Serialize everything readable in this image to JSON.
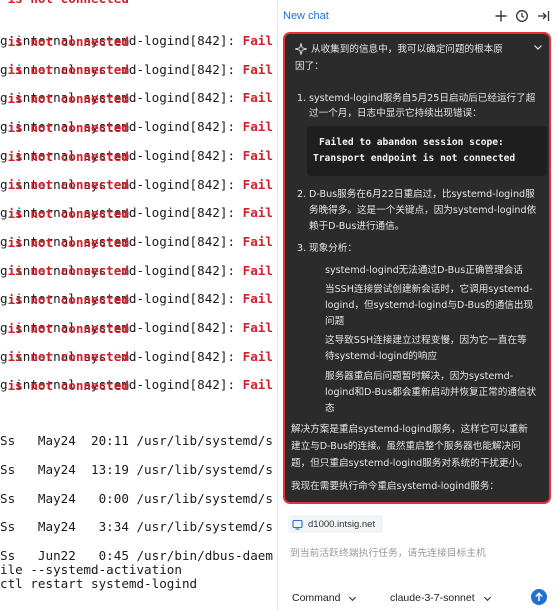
{
  "terminal": {
    "log_prefix": "g.internal systemd-logind[842]: ",
    "fail_word": "Fail",
    "fail_continuation": " is not connected",
    "process_lines": [
      {
        "stat": "Ss",
        "month": "May24",
        "time": "20:11",
        "cmd": "/usr/lib/systemd/s"
      },
      {
        "stat": "Ss",
        "month": "May24",
        "time": "13:19",
        "cmd": "/usr/lib/systemd/s"
      },
      {
        "stat": "Ss",
        "month": "May24",
        "time": " 0:00",
        "cmd": "/usr/lib/systemd/s"
      },
      {
        "stat": "Ss",
        "month": "May24",
        "time": " 3:34",
        "cmd": "/usr/lib/systemd/s"
      },
      {
        "stat": "Ss",
        "month": "Jun22",
        "time": " 0:45",
        "cmd": "/usr/bin/dbus-daem"
      }
    ],
    "line_activation": "ile --systemd-activation",
    "line_restart": "ctl restart systemd-logind"
  },
  "chat": {
    "tab_label": "New chat",
    "icons": {
      "plus": "plus-icon",
      "history": "history-icon",
      "collapse": "collapse-panel-icon",
      "sparkle": "sparkle-icon",
      "chevron": "chevron-down-icon",
      "send": "send-icon",
      "host": "server-icon"
    },
    "response": {
      "intro_1": "从收集到的信息中，我可以确定问题的根本原",
      "intro_2": "因了：",
      "item1_num": "1.",
      "item1_l1": "systemd-logind服务自5月25日启动后已经运行了超",
      "item1_l2": "过一个月，日志中显示它持续出现错误：",
      "code_l1": "Failed to abandon session scope:",
      "code_l2": "Transport endpoint is not connected",
      "item2_num": "2.",
      "item2_l1": "D-Bus服务在6月22日重启过，比systemd-logind服",
      "item2_l2": "务晚得多。这是一个关键点，因为systemd-logind依",
      "item2_l3": "赖于D-Bus进行通信。",
      "item3_num": "3.",
      "item3_title": "现象分析：",
      "sub1": "systemd-logind无法通过D-Bus正确管理会话",
      "sub2_l1": "当SSH连接尝试创建新会话时，它调用systemd-",
      "sub2_l2": "logind，但systemd-logind与D-Bus的通信出现",
      "sub2_l3": "问题",
      "sub3_l1": "这导致SSH连接建立过程变慢，因为它一直在等",
      "sub3_l2": "待systemd-logind的响应",
      "sub4_l1": "服务器重启后问题暂时解决，因为systemd-",
      "sub4_l2": "logind和D-Bus都会重新启动并恢复正常的通信状",
      "sub4_l3": "态",
      "para_l1": "解决方案是重启systemd-logind服务，这样它可以重新",
      "para_l2": "建立与D-Bus的连接。虽然重启整个服务器也能解决问",
      "para_l3": "题，但只重启systemd-logind服务对系统的干扰更小。",
      "final": "我现在需要执行命令重启systemd-logind服务："
    },
    "host": "d1000.intsig.net",
    "input_placeholder": "到当前活跃终端执行任务，请先连接目标主机",
    "mode": "Command",
    "model": "claude-3-7-sonnet"
  }
}
